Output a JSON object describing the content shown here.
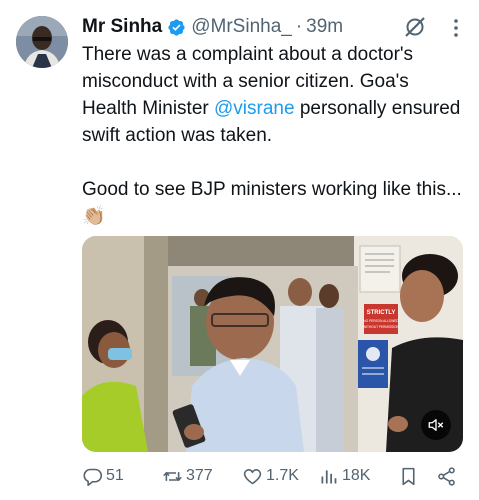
{
  "post": {
    "author_name": "Mr Sinha",
    "handle": "@MrSinha_",
    "separator": "·",
    "time": "39m",
    "text_before_mention": "There was a complaint about a doctor's misconduct with a senior citizen. Goa's Health Minister ",
    "mention": "@visrane",
    "text_after_mention": " personally ensured swift action was taken.\n\nGood to see BJP ministers working like this... 👏🏼"
  },
  "media": {
    "sign_text_1": "STRICTLY",
    "sign_text_2": "NO PERSON ALLOWED",
    "sign_text_3": "WITHOUT PERMISSION",
    "sign_text_4": "ENTER",
    "sign_text_5": "WITH PER...",
    "sign_text_6": "PATIENT WARD"
  },
  "actions": {
    "replies": "51",
    "reposts": "377",
    "likes": "1.7K",
    "views": "18K"
  },
  "colors": {
    "accent": "#1d9bf0",
    "muted": "#536471",
    "text": "#0f1419"
  }
}
